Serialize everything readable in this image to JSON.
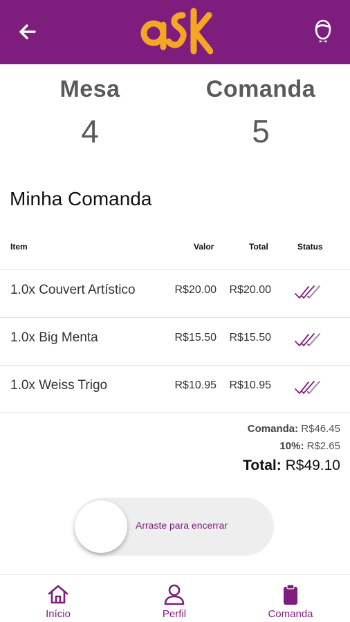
{
  "header": {
    "back_icon": "arrow-left-icon",
    "logo_text": "aSK",
    "profile_icon": "waiter-avatar-icon"
  },
  "summary": {
    "mesa_label": "Mesa",
    "mesa_value": "4",
    "comanda_label": "Comanda",
    "comanda_value": "5"
  },
  "section_title": "Minha Comanda",
  "table": {
    "headers": {
      "item": "Item",
      "valor": "Valor",
      "total": "Total",
      "status": "Status"
    },
    "rows": [
      {
        "name": "1.0x Couvert Artístico",
        "valor": "R$20.00",
        "total": "R$20.00",
        "status_icon": "double-check-icon"
      },
      {
        "name": "1.0x Big Menta",
        "valor": "R$15.50",
        "total": "R$15.50",
        "status_icon": "double-check-icon"
      },
      {
        "name": "1.0x Weiss Trigo",
        "valor": "R$10.95",
        "total": "R$10.95",
        "status_icon": "double-check-icon"
      }
    ]
  },
  "totals": {
    "comanda_label": "Comanda:",
    "comanda_value": "R$46.45",
    "service_label": "10%:",
    "service_value": "R$2.65",
    "total_label": "Total:",
    "total_value": "R$49.10"
  },
  "slider": {
    "text": "Arraste para encerrar"
  },
  "bottom_nav": {
    "items": [
      {
        "label": "Início",
        "icon": "home-icon"
      },
      {
        "label": "Perfil",
        "icon": "user-icon"
      },
      {
        "label": "Comanda",
        "icon": "clipboard-icon"
      }
    ]
  },
  "colors": {
    "brand": "#7d1d7d",
    "logo": "#f5a623"
  }
}
